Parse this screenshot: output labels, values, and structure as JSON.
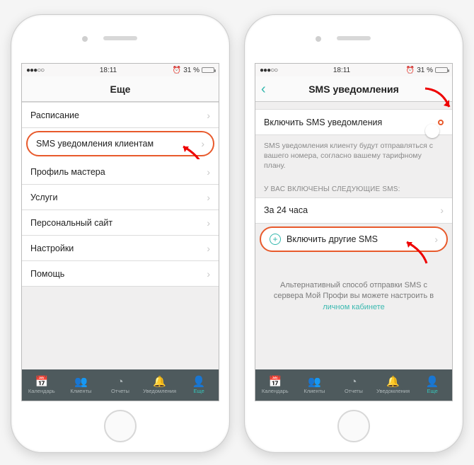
{
  "status": {
    "time": "18:11",
    "battery_pct": "31 %",
    "signal": "●●●○○",
    "alarm_glyph": "⏰"
  },
  "left": {
    "header_title": "Еще",
    "menu": [
      {
        "label": "Расписание"
      },
      {
        "label": "SMS уведомления клиентам",
        "highlight": true
      },
      {
        "label": "Профиль мастера"
      },
      {
        "label": "Услуги"
      },
      {
        "label": "Персональный сайт"
      },
      {
        "label": "Настройки"
      },
      {
        "label": "Помощь"
      }
    ]
  },
  "right": {
    "header_title": "SMS уведомления",
    "toggle_row_label": "Включить SMS уведомления",
    "toggle_on": true,
    "note": "SMS уведомления клиенту будут отправляться с вашего номера, согласно вашему тарифному плану.",
    "section_head": "У ВАС ВКЛЮЧЕНЫ СЛЕДУЮЩИЕ SMS:",
    "enabled_rows": [
      {
        "label": "За 24 часа"
      }
    ],
    "add_more_label": "Включить другие SMS",
    "alt_text_prefix": "Альтернативный способ отправки SMS с сервера Мой Профи вы можете настроить в ",
    "alt_text_link": "личном кабинете"
  },
  "tabs": [
    {
      "label": "Календарь",
      "glyph": "📅"
    },
    {
      "label": "Клиенты",
      "glyph": "👥"
    },
    {
      "label": "Отчеты",
      "glyph": "◔"
    },
    {
      "label": "Уведомления",
      "glyph": "🔔"
    },
    {
      "label": "Еще",
      "glyph": "👤",
      "active": true
    }
  ],
  "colors": {
    "accent": "#36c3b8",
    "highlight": "#e85a2c",
    "tabbar": "#4e5a5d"
  }
}
